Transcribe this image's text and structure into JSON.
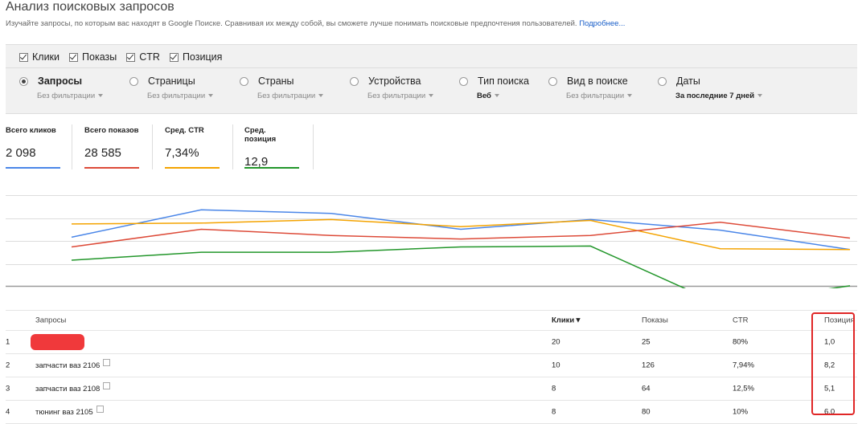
{
  "page": {
    "title": "Анализ поисковых запросов",
    "subtitle": "Изучайте запросы, по которым вас находят в Google Поиске. Сравнивая их между собой, вы сможете лучше понимать поисковые предпочтения пользователей.",
    "more_link": "Подробнее..."
  },
  "metric_toggles": [
    {
      "label": "Клики",
      "checked": true
    },
    {
      "label": "Показы",
      "checked": true
    },
    {
      "label": "CTR",
      "checked": true
    },
    {
      "label": "Позиция",
      "checked": true
    }
  ],
  "dimensions": [
    {
      "label": "Запросы",
      "filter": "Без фильтрации",
      "selected": true
    },
    {
      "label": "Страницы",
      "filter": "Без фильтрации",
      "selected": false
    },
    {
      "label": "Страны",
      "filter": "Без фильтрации",
      "selected": false
    },
    {
      "label": "Устройства",
      "filter": "Без фильтрации",
      "selected": false
    },
    {
      "label": "Тип поиска",
      "filter": "Веб",
      "selected": false
    },
    {
      "label": "Вид в поиске",
      "filter": "Без фильтрации",
      "selected": false
    },
    {
      "label": "Даты",
      "filter": "За последние 7 дней",
      "selected": false
    }
  ],
  "totals": [
    {
      "label": "Всего кликов",
      "value": "2 098",
      "color": "#4a86e8"
    },
    {
      "label": "Всего показов",
      "value": "28 585",
      "color": "#dd4b39"
    },
    {
      "label": "Сред. CTR",
      "value": "7,34%",
      "color": "#f4a300"
    },
    {
      "label": "Сред. позиция",
      "value": "12,9",
      "color": "#22962a"
    }
  ],
  "chart_data": {
    "type": "line",
    "x": [
      1,
      2,
      3,
      4,
      5,
      6,
      7
    ],
    "series": [
      {
        "color": "#4a86e8",
        "values": [
          0.56,
          0.87,
          0.83,
          0.65,
          0.76,
          0.64,
          0.42
        ]
      },
      {
        "color": "#f4a300",
        "values": [
          0.71,
          0.72,
          0.76,
          0.68,
          0.75,
          0.43,
          0.42
        ]
      },
      {
        "color": "#dd4b39",
        "values": [
          0.45,
          0.65,
          0.58,
          0.54,
          0.58,
          0.73,
          0.55
        ]
      },
      {
        "color": "#22962a",
        "values": [
          0.3,
          0.39,
          0.39,
          0.45,
          0.46,
          -0.2,
          0.01
        ]
      }
    ]
  },
  "table": {
    "headers": {
      "query": "Запросы",
      "clicks": "Клики",
      "impressions": "Показы",
      "ctr": "CTR",
      "position": "Позиция"
    },
    "sort_indicator": "▼",
    "rows": [
      {
        "n": "1",
        "query": "",
        "redacted": true,
        "clicks": "20",
        "impressions": "25",
        "ctr": "80%",
        "position": "1,0"
      },
      {
        "n": "2",
        "query": "запчасти ваз 2106",
        "redacted": false,
        "clicks": "10",
        "impressions": "126",
        "ctr": "7,94%",
        "position": "8,2"
      },
      {
        "n": "3",
        "query": "запчасти ваз 2108",
        "redacted": false,
        "clicks": "8",
        "impressions": "64",
        "ctr": "12,5%",
        "position": "5,1"
      },
      {
        "n": "4",
        "query": "тюнинг ваз 2105",
        "redacted": false,
        "clicks": "8",
        "impressions": "80",
        "ctr": "10%",
        "position": "6,0"
      }
    ]
  },
  "colors": {
    "highlight": "#e02626",
    "redaction": "#f0393b"
  }
}
